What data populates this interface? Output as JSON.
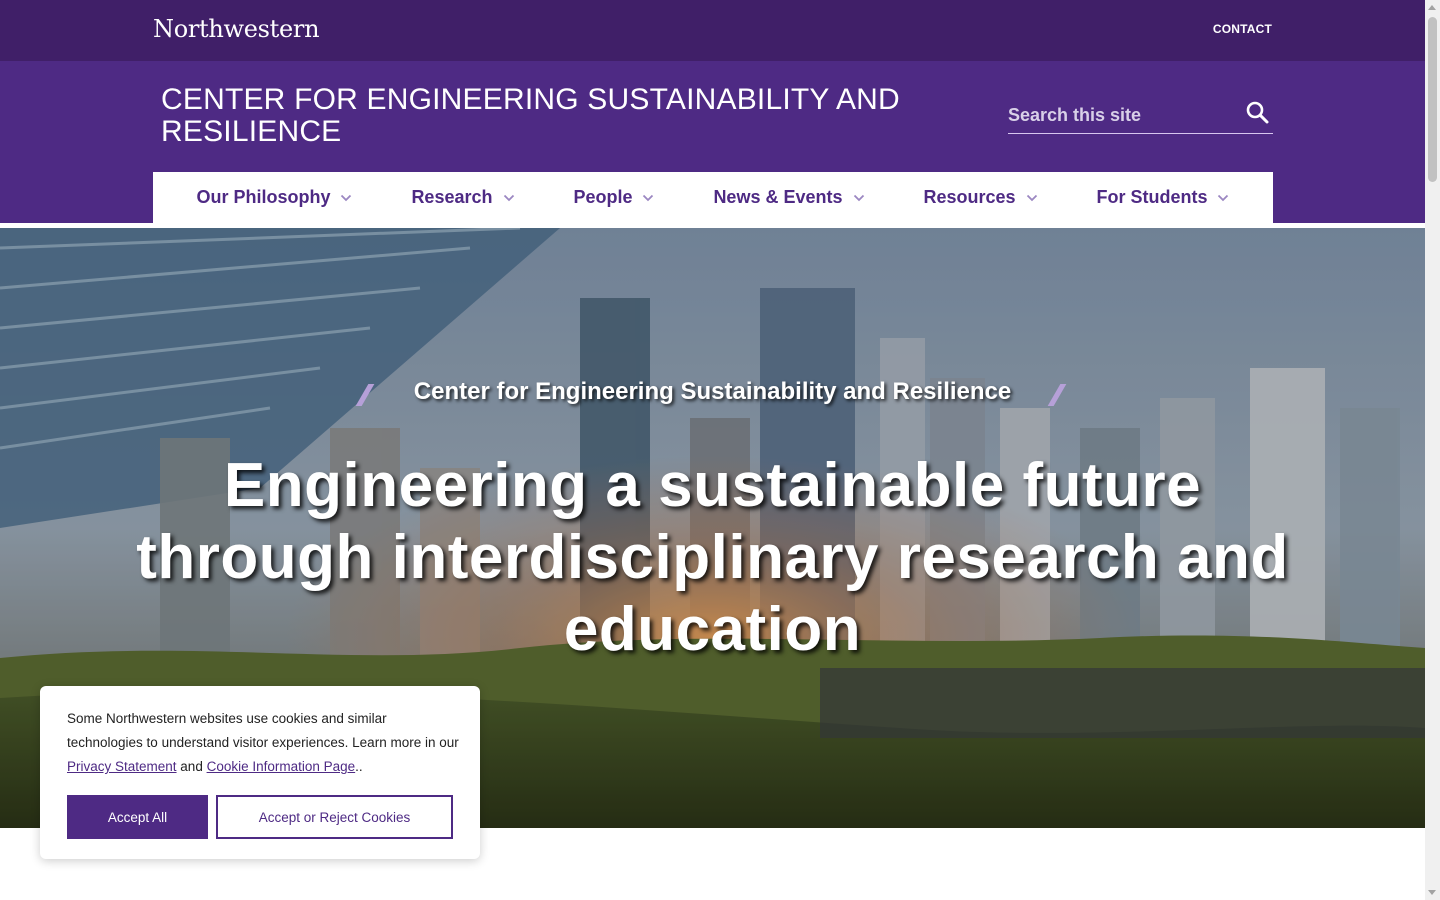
{
  "topbar": {
    "brand": "Northwestern",
    "contact_label": "CONTACT"
  },
  "header": {
    "site_title": "CENTER FOR ENGINEERING SUSTAINABILITY AND RESILIENCE",
    "search_placeholder": "Search this site",
    "search_icon": "search-icon"
  },
  "nav": {
    "items": [
      {
        "label": "Our Philosophy",
        "icon": "chevron-down-icon"
      },
      {
        "label": "Research",
        "icon": "chevron-down-icon"
      },
      {
        "label": "People",
        "icon": "chevron-down-icon"
      },
      {
        "label": "News & Events",
        "icon": "chevron-down-icon"
      },
      {
        "label": "Resources",
        "icon": "chevron-down-icon"
      },
      {
        "label": "For Students",
        "icon": "chevron-down-icon"
      }
    ]
  },
  "hero": {
    "kicker": "Center for Engineering Sustainability and Resilience",
    "title": "Engineering a sustainable future through interdisciplinary research and education"
  },
  "cookie": {
    "text_before": "Some Northwestern websites use cookies and similar technologies to understand visitor experiences. Learn more in our ",
    "privacy_link": "Privacy Statement",
    "text_and": " and ",
    "cookie_link": "Cookie Information Page",
    "text_after": "..",
    "accept_all": "Accept All",
    "accept_reject": "Accept or Reject Cookies"
  },
  "colors": {
    "topbar": "#401f68",
    "brand_purple": "#4e2a84",
    "white": "#ffffff"
  }
}
